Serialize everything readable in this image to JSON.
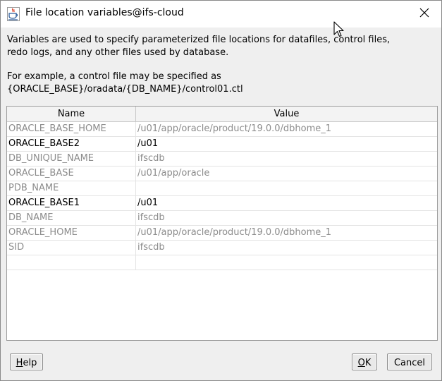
{
  "window": {
    "title": "File location variables@ifs-cloud"
  },
  "description": {
    "line1": "Variables are used to specify parameterized file locations for datafiles, control files,",
    "line2": "redo logs, and any other files used by database.",
    "example_line1": "For example, a control file may be specified as",
    "example_line2": "{ORACLE_BASE}/oradata/{DB_NAME}/control01.ctl"
  },
  "table": {
    "columns": [
      "Name",
      "Value"
    ],
    "rows": [
      {
        "name": "ORACLE_BASE_HOME",
        "value": "/u01/app/oracle/product/19.0.0/dbhome_1",
        "style": "inherited"
      },
      {
        "name": "ORACLE_BASE2",
        "value": "/u01",
        "style": "custom"
      },
      {
        "name": "DB_UNIQUE_NAME",
        "value": "ifscdb",
        "style": "inherited"
      },
      {
        "name": "ORACLE_BASE",
        "value": "/u01/app/oracle",
        "style": "inherited"
      },
      {
        "name": "PDB_NAME",
        "value": "",
        "style": "inherited"
      },
      {
        "name": "ORACLE_BASE1",
        "value": "/u01",
        "style": "custom"
      },
      {
        "name": "DB_NAME",
        "value": "ifscdb",
        "style": "inherited"
      },
      {
        "name": "ORACLE_HOME",
        "value": "/u01/app/oracle/product/19.0.0/dbhome_1",
        "style": "inherited"
      },
      {
        "name": "SID",
        "value": "ifscdb",
        "style": "inherited"
      },
      {
        "name": "",
        "value": "",
        "style": "custom"
      }
    ]
  },
  "buttons": {
    "help_mnemonic": "H",
    "help_rest": "elp",
    "ok_mnemonic": "O",
    "ok_rest": "K",
    "cancel": "Cancel"
  },
  "colors": {
    "inherited_text": "#8c8c8c",
    "custom_text": "#000000",
    "dialog_bg": "#efefef"
  },
  "icons": {
    "app": "java-coffee-cup-icon",
    "close": "close-icon",
    "cursor": "mouse-pointer-icon"
  }
}
